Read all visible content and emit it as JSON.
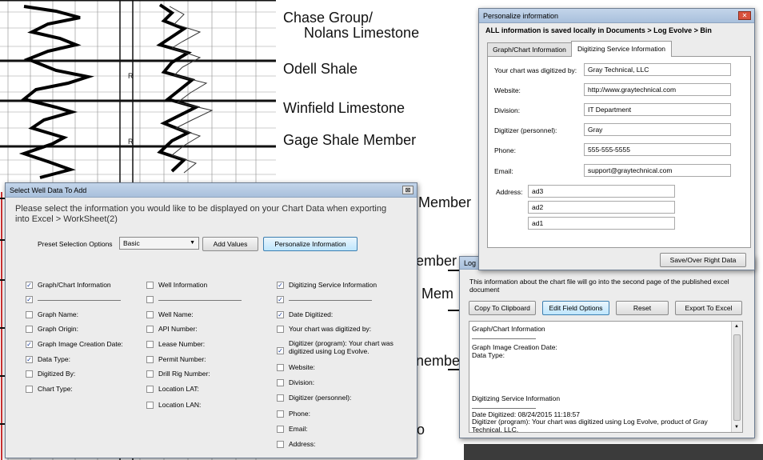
{
  "formations": [
    "Chase Group/",
    "Nolans Limestone",
    "Odell Shale",
    "Winfield Limestone",
    "Gage Shale Member"
  ],
  "log_fragments": [
    "Member",
    "ember",
    "Mem",
    "nembe",
    "embe",
    "o",
    "R",
    "R"
  ],
  "select_dialog": {
    "title": "Select Well Data To Add",
    "close_glyph": "⊠",
    "instruction": "Please select the information you would like to be displayed on your Chart Data when exporting into Excel > WorkSheet(2)",
    "preset_label": "Preset Selection Options",
    "preset_value": "Basic",
    "add_values": "Add Values",
    "personalize": "Personalize Information",
    "col1": [
      {
        "label": "Graph/Chart Information",
        "checked": true
      },
      {
        "label": "——————————",
        "checked": true
      },
      {
        "label": "Graph Name:",
        "checked": false
      },
      {
        "label": "Graph Origin:",
        "checked": false
      },
      {
        "label": "Graph Image Creation Date:",
        "checked": true
      },
      {
        "label": "Data Type:",
        "checked": true
      },
      {
        "label": "Digitized By:",
        "checked": false
      },
      {
        "label": "Chart Type:",
        "checked": false
      }
    ],
    "col2": [
      {
        "label": "Well Information",
        "checked": false
      },
      {
        "label": "——————————",
        "checked": false
      },
      {
        "label": "Well Name:",
        "checked": false
      },
      {
        "label": "API Number:",
        "checked": false
      },
      {
        "label": "Lease Number:",
        "checked": false
      },
      {
        "label": "Permit Number:",
        "checked": false
      },
      {
        "label": "Drill Rig Number:",
        "checked": false
      },
      {
        "label": "Location LAT:",
        "checked": false
      },
      {
        "label": "Location LAN:",
        "checked": false
      }
    ],
    "col3": [
      {
        "label": "Digitizing Service Information",
        "checked": true
      },
      {
        "label": "——————————",
        "checked": true
      },
      {
        "label": "Date Digitized:",
        "checked": true
      },
      {
        "label": "Your chart was digitized by:",
        "checked": false
      },
      {
        "label": "Digitizer (program): Your chart was digitized using Log Evolve.",
        "checked": true
      },
      {
        "label": "Website:",
        "checked": false
      },
      {
        "label": "Division:",
        "checked": false
      },
      {
        "label": "Digitizer (personnel):",
        "checked": false
      },
      {
        "label": "Phone:",
        "checked": false
      },
      {
        "label": "Email:",
        "checked": false
      },
      {
        "label": "Address:",
        "checked": false
      }
    ]
  },
  "personalize_dialog": {
    "title": "Personalize information",
    "close_glyph": "✕",
    "banner": "ALL information is saved locally in Documents > Log Evolve > Bin",
    "tabs": [
      "Graph/Chart Information",
      "Digitizing Service Information"
    ],
    "fields": [
      {
        "label": "Your chart was digitized by:",
        "value": "Gray Technical, LLC"
      },
      {
        "label": "Website:",
        "value": "http://www.graytechnical.com"
      },
      {
        "label": "Division:",
        "value": "IT Department"
      },
      {
        "label": "Digitizer (personnel):",
        "value": "Gray"
      },
      {
        "label": "Phone:",
        "value": "555-555-5555"
      },
      {
        "label": "Email:",
        "value": "support@graytechnical.com"
      }
    ],
    "address_label": "Address:",
    "address_lines": [
      "ad3",
      "ad2",
      "ad1"
    ],
    "save_button": "Save/Over Right Data"
  },
  "log_dialog": {
    "title": "Log",
    "description": "This information about the chart file will go into the second page of the published excel document",
    "buttons": [
      "Copy To Clipboard",
      "Edit Field Options",
      "Reset",
      "Export To Excel"
    ],
    "output": {
      "l1": "Graph/Chart Information",
      "l2": "——————————",
      "l3": "Graph Image Creation Date:",
      "l4": "Data Type:",
      "l5": "Digitizing Service Information",
      "l6": "——————————",
      "l7": "Date Digitized: 08/24/2015  11:18:57",
      "l8": "Digitizer (program): Your chart was digitized using Log Evolve, product of Gray Technical, LLC."
    }
  }
}
